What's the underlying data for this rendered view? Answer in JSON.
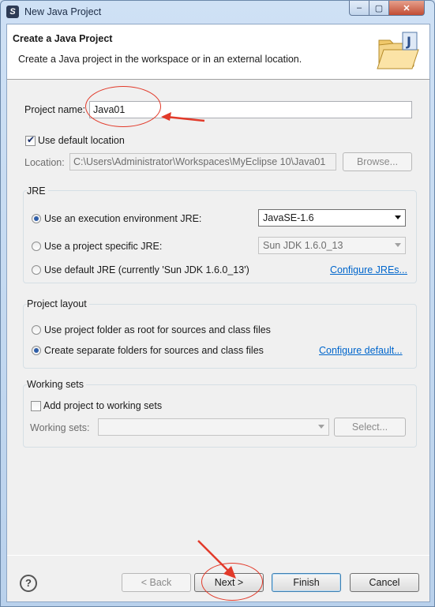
{
  "window": {
    "title": "New Java Project",
    "app_icon_glyph": "S",
    "minimize_glyph": "–",
    "maximize_glyph": "▢",
    "close_glyph": "✕"
  },
  "banner": {
    "title": "Create a Java Project",
    "description": "Create a Java project in the workspace or in an external location.",
    "icon": "java-project-folder-icon"
  },
  "project": {
    "name_label": "Project name:",
    "name_value": "Java01",
    "use_default_location_label": "Use default location",
    "use_default_location_checked": true,
    "location_label": "Location:",
    "location_value": "C:\\Users\\Administrator\\Workspaces\\MyEclipse 10\\Java01",
    "browse_label": "Browse..."
  },
  "jre": {
    "group_title": "JRE",
    "option_env_label": "Use an execution environment JRE:",
    "option_env_value": "JavaSE-1.6",
    "option_specific_label": "Use a project specific JRE:",
    "option_specific_value": "Sun JDK 1.6.0_13",
    "option_default_label": "Use default JRE (currently 'Sun JDK 1.6.0_13')",
    "configure_link": "Configure JREs...",
    "selected": "env"
  },
  "layout": {
    "group_title": "Project layout",
    "option_root_label": "Use project folder as root for sources and class files",
    "option_separate_label": "Create separate folders for sources and class files",
    "configure_link": "Configure default...",
    "selected": "separate"
  },
  "working_sets": {
    "group_title": "Working sets",
    "add_label": "Add project to working sets",
    "add_checked": false,
    "field_label": "Working sets:",
    "field_value": "",
    "select_label": "Select..."
  },
  "footer": {
    "help_glyph": "?",
    "back_label": "< Back",
    "next_label": "Next >",
    "finish_label": "Finish",
    "cancel_label": "Cancel"
  },
  "colors": {
    "link": "#0066cc",
    "annotation": "#e23a2a"
  }
}
